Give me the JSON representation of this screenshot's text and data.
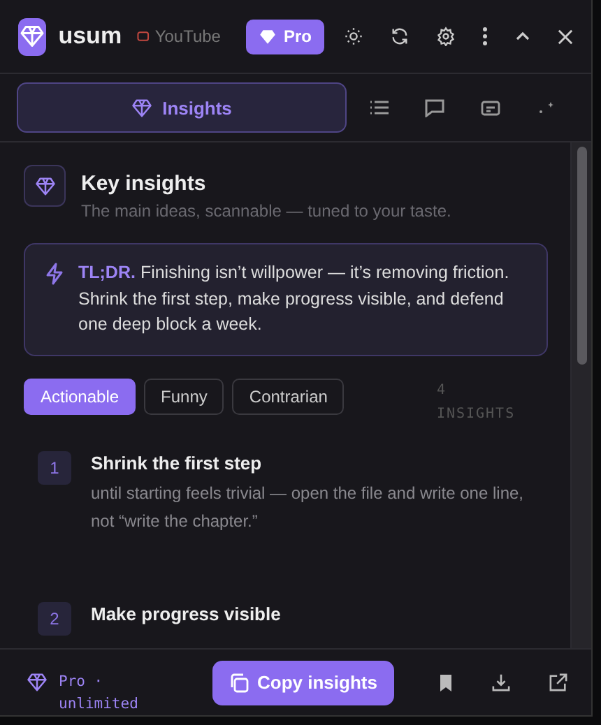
{
  "header": {
    "app_name": "usum",
    "source": "YouTube",
    "plan_badge": "Pro"
  },
  "tabs": [
    {
      "kind": "insights",
      "label": "Insights",
      "selected": true
    },
    {
      "kind": "list",
      "selected": false
    },
    {
      "kind": "chat",
      "selected": false
    },
    {
      "kind": "card",
      "selected": false
    },
    {
      "kind": "sparkle",
      "selected": false
    }
  ],
  "section": {
    "title": "Key insights",
    "subtitle": "The main ideas, scannable — tuned to your taste."
  },
  "tldr": "**TL;DR.** Finishing isn’t willpower — it’s removing friction. Shrink the first step, make progress visible, and defend one deep block a week.",
  "filters": [
    {
      "label": "Actionable",
      "selected": true
    },
    {
      "label": "Funny",
      "selected": false
    },
    {
      "label": "Contrarian",
      "selected": false
    }
  ],
  "count": "4 INSIGHTS",
  "insights": [
    {
      "number": "1",
      "title": "Shrink the first step",
      "body": "until starting feels trivial — open the file and write one line, not “write the chapter.”"
    },
    {
      "number": "2",
      "title": "Make progress visible"
    }
  ],
  "footer": {
    "plan": "Pro · unlimited",
    "copy_button": "Copy insights"
  }
}
